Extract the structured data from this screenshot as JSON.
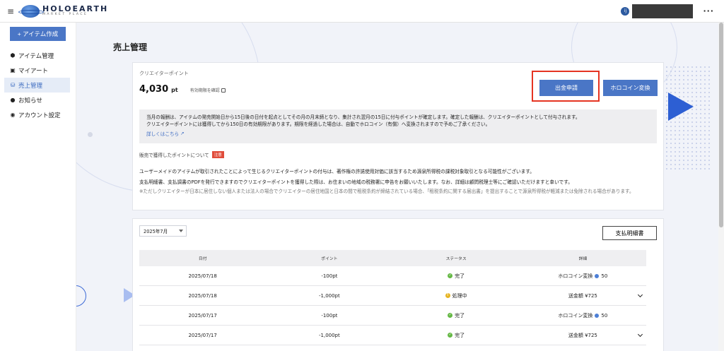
{
  "header": {
    "logo_main": "HOLOEARTH",
    "logo_sub": "MARKET PLACE",
    "avatar_initial": "ij"
  },
  "sidebar": {
    "create_button": "+ アイテム作成",
    "items": [
      {
        "label": "アイテム管理",
        "icon": "cube-icon",
        "active": false
      },
      {
        "label": "マイアート",
        "icon": "image-icon",
        "active": false
      },
      {
        "label": "売上管理",
        "icon": "sales-icon",
        "active": true
      },
      {
        "label": "お知らせ",
        "icon": "notice-icon",
        "active": false
      },
      {
        "label": "アカウント設定",
        "icon": "account-icon",
        "active": false
      }
    ]
  },
  "main": {
    "page_title": "売上管理",
    "points_card": {
      "label": "クリエイターポイント",
      "value": "4,030",
      "unit": "pt",
      "expiry_link": "有効期限を確認",
      "withdraw_button": "出金申請",
      "convert_button": "ホロコイン変換",
      "info_lines": [
        "当月の報酬は、アイテムの発売開始日から15日後の日付を起点としてその月の月末締となり、集計され翌月の15日に付与ポイントが確定します。確定した報酬は、クリエイターポイントとして付与されます。",
        "クリエイターポイントには獲得してから150日の有効期限があります。期限を経過した場合は、自動でホロコイン（有償）へ変換されますので予めご了承ください。"
      ],
      "info_link": "詳しくはこちら",
      "notice_title": "販売で獲得したポイントについて",
      "notice_badge": "注意",
      "notice_line1": "ユーザーメイドのアイテムが取引されたことによって生じるクリエイターポイントの付与は、著作権の許諾使用対価に該当するため源泉所得税の課税対象取引となる可能性がございます。",
      "notice_line2": "支払明細書、支払調書のPDFを発行できますのでクリエイターポイントを獲得した際は、お住まいの地域の税務署に申告をお願いいたします。なお、詳細は顧問税理士等にご確認いただけますと幸いです。",
      "notice_grey": "※ただしクリエイターが日本に居住しない個人または法人の場合でクリエイターの居住地国と日本の間で租税条約が締結されている場合、「租税条約に関する届出書」を提出することで源泉所得税が軽減または免除される場合があります。"
    },
    "history": {
      "month_select": "2025年7月",
      "statement_button": "支払明細書",
      "columns": [
        "日付",
        "ポイント",
        "ステータス",
        "詳細"
      ],
      "rows": [
        {
          "date": "2025/07/18",
          "points": "-100pt",
          "status": "完了",
          "status_type": "ok",
          "detail": "ホロコイン変換",
          "detail_amount": "50",
          "coin": true,
          "expandable": false
        },
        {
          "date": "2025/07/18",
          "points": "-1,000pt",
          "status": "処理中",
          "status_type": "wait",
          "detail": "送金額 ¥725",
          "detail_amount": "",
          "coin": false,
          "expandable": true
        },
        {
          "date": "2025/07/17",
          "points": "-100pt",
          "status": "完了",
          "status_type": "ok",
          "detail": "ホロコイン変換",
          "detail_amount": "50",
          "coin": true,
          "expandable": false
        },
        {
          "date": "2025/07/17",
          "points": "-1,000pt",
          "status": "完了",
          "status_type": "ok",
          "detail": "送金額 ¥725",
          "detail_amount": "",
          "coin": false,
          "expandable": true
        }
      ]
    }
  },
  "colors": {
    "accent": "#4a76c6",
    "highlight": "#e53422",
    "badge": "#e04c3a",
    "status_ok": "#65b845",
    "status_wait": "#e6b422"
  }
}
